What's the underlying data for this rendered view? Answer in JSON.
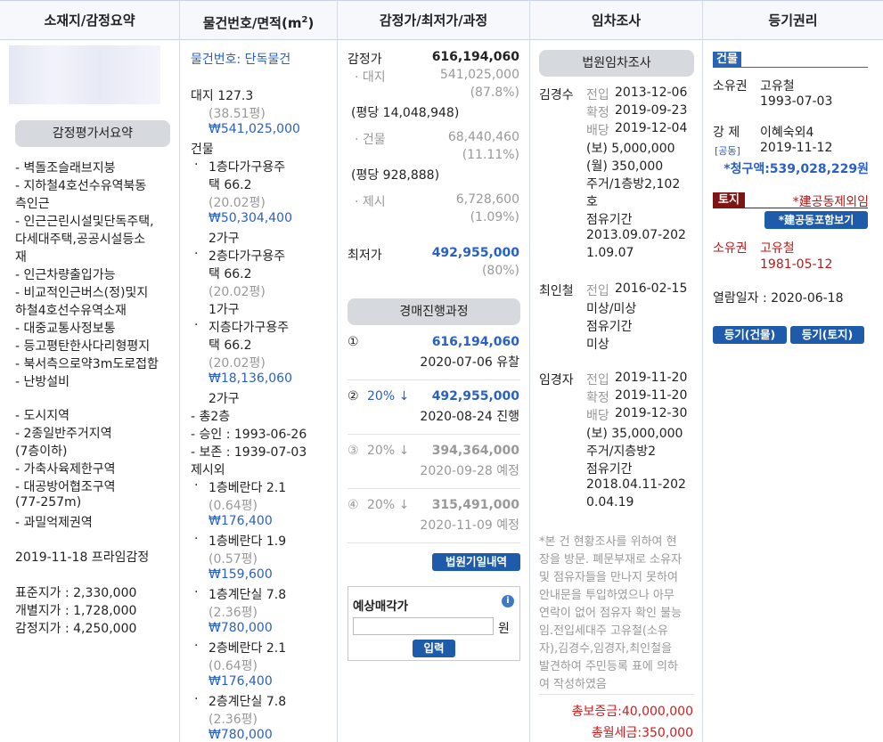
{
  "headers": [
    "소재지/감정요약",
    "물건번호/면적",
    "감정가/최저가/과정",
    "임차조사",
    "등기권리"
  ],
  "header_unit": "(m",
  "header_unit_sup": "2",
  "header_unit_close": ")",
  "col1": {
    "summary_pill": "감정평가서요약",
    "bullets1": [
      "- 벽돌조슬래브지붕",
      "- 지하철4호선수유역북동",
      "   측인근",
      "- 인근근린시설및단독주택,",
      "   다세대주택,공공시설등소",
      "   재",
      "- 인근차량출입가능",
      "- 비교적인근버스(정)및지",
      "   하철4호선수유역소재",
      "- 대중교통사정보통",
      "- 등고평탄한사다리형평지",
      "- 북서측으로약3m도로접함",
      "- 난방설비"
    ],
    "bullets2": [
      "- 도시지역",
      "- 2종일반주거지역",
      "   (7층이하)",
      "- 가축사육제한구역",
      "- 대공방어협조구역",
      "   (77-257m)",
      "- 과밀억제권역"
    ],
    "appraisal_date": "2019-11-18 프라임감정",
    "prices": [
      "표준지가 : 2,330,000",
      "개별지가 : 1,728,000",
      "감정지가 : 4,250,000"
    ]
  },
  "col2": {
    "item_no": "물건번호: 단독물건",
    "land_label": "대지 127.3",
    "land_pyeong": "(38.51평)",
    "land_price": "₩541,025,000",
    "building_label": "건물",
    "building_items": [
      {
        "l1": "1층다가구용주",
        "l2": "택 66.2",
        "pyeong": "(20.02평)",
        "price": "₩50,304,400",
        "units": "2가구"
      },
      {
        "l1": "2층다가구용주",
        "l2": "택 66.2",
        "pyeong": "(20.02평)",
        "price": "",
        "units": "1가구"
      },
      {
        "l1": "지층다가구용주",
        "l2": "택 66.2",
        "pyeong": "(20.02평)",
        "price": "₩18,136,060",
        "units": "2가구"
      }
    ],
    "meta": [
      "- 총2층",
      "- 승인 : 1993-06-26",
      "- 보존 : 1939-07-03"
    ],
    "excluded_label": "제시외",
    "excluded_items": [
      {
        "l1": "1층베란다 2.1",
        "pyeong": "(0.64평)",
        "price": "₩176,400"
      },
      {
        "l1": "1층베란다 1.9",
        "pyeong": "(0.57평)",
        "price": "₩159,600"
      },
      {
        "l1": "1층계단실 7.8",
        "pyeong": "(2.36평)",
        "price": "₩780,000"
      },
      {
        "l1": "2층베란다 2.1",
        "pyeong": "(0.64평)",
        "price": "₩176,400"
      },
      {
        "l1": "2층계단실 7.8",
        "pyeong": "(2.36평)",
        "price": "₩780,000"
      }
    ]
  },
  "col3": {
    "appraisal_label": "감정가",
    "appraisal_value": "616,194,060",
    "land_label": "· 대지",
    "land_value": "541,025,000",
    "land_pct": "(87.8%)",
    "land_per": "(평당 14,048,948)",
    "bld_label": "· 건물",
    "bld_value": "68,440,460",
    "bld_pct": "(11.11%)",
    "bld_per": "(평당 928,888)",
    "etc_label": "· 제시",
    "etc_value": "6,728,600",
    "etc_pct": "(1.09%)",
    "min_label": "최저가",
    "min_value": "492,955,000",
    "min_pct": "(80%)",
    "process_pill": "경매진행과정",
    "rounds": [
      {
        "no": "①",
        "rate": "",
        "price": "616,194,060",
        "date": "2020-07-06",
        "status": "유찰"
      },
      {
        "no": "②",
        "rate": "20% ↓",
        "price": "492,955,000",
        "date": "2020-08-24",
        "status": "진행"
      },
      {
        "no": "③",
        "rate": "20% ↓",
        "price": "394,364,000",
        "date": "2020-09-28",
        "status": "예정"
      },
      {
        "no": "④",
        "rate": "20% ↓",
        "price": "315,491,000",
        "date": "2020-11-09",
        "status": "예정"
      }
    ],
    "court_btn": "법원기일내역",
    "estimate_label": "예상매각가",
    "estimate_unit": "원",
    "estimate_btn": "입력",
    "estimate_value": ""
  },
  "col4": {
    "pill": "법원임차조사",
    "tenants": [
      {
        "name": "김경수",
        "rows": [
          [
            "전입",
            "2013-12-06"
          ],
          [
            "확정",
            "2019-09-23"
          ],
          [
            "배당",
            "2019-12-04"
          ]
        ],
        "extra": [
          "(보)      5,000,000",
          "(월)          350,000",
          "주거/1층방2,102",
          "호",
          "점유기간",
          "2013.09.07-202",
          "1.09.07"
        ]
      },
      {
        "name": "최인철",
        "rows": [
          [
            "전입",
            "2016-02-15"
          ]
        ],
        "extra": [
          "미상/미상",
          "점유기간",
          "미상"
        ]
      },
      {
        "name": "임경자",
        "rows": [
          [
            "전입",
            "2019-11-20"
          ],
          [
            "확정",
            "2019-11-20"
          ],
          [
            "배당",
            "2019-12-30"
          ]
        ],
        "extra": [
          "(보)  35,000,000",
          "주거/지층방2",
          "점유기간",
          "2018.04.11-202",
          "0.04.19"
        ]
      }
    ],
    "note": [
      "*본 건 현황조사를 위하여 현",
      "장을 방문. 폐문부재로 소유자",
      "및 점유자들을 만나지 못하여",
      "안내문을 투입하였으나 아무",
      "연락이 없어 점유자 확인 불능",
      "임.전입세대주 고유철(소유",
      "자),김경수,임경자,최인철을",
      "발견하여 주민등록 표에 의하",
      "여 작성하였음"
    ],
    "total_deposit": "총보증금:40,000,000",
    "total_rent": "총월세금:350,000"
  },
  "col5": {
    "building_tag": "건물",
    "owner_label": "소유권",
    "owner_name": "고유철",
    "owner_date": "1993-07-03",
    "seizure_label": "강  제",
    "seizure_name": "이혜숙외4",
    "seizure_sub": "[공동]",
    "seizure_date": "2019-11-12",
    "claim": "*청구액:539,028,229원",
    "land_tag": "토지",
    "land_note": "*建공동제외임",
    "shared_btn": "*建공동포함보기",
    "land_owner_label": "소유권",
    "land_owner_name": "고유철",
    "land_owner_date": "1981-05-12",
    "view_date": "열람일자 : 2020-06-18",
    "btn_building": "등기(건물)",
    "btn_land": "등기(토지)"
  }
}
